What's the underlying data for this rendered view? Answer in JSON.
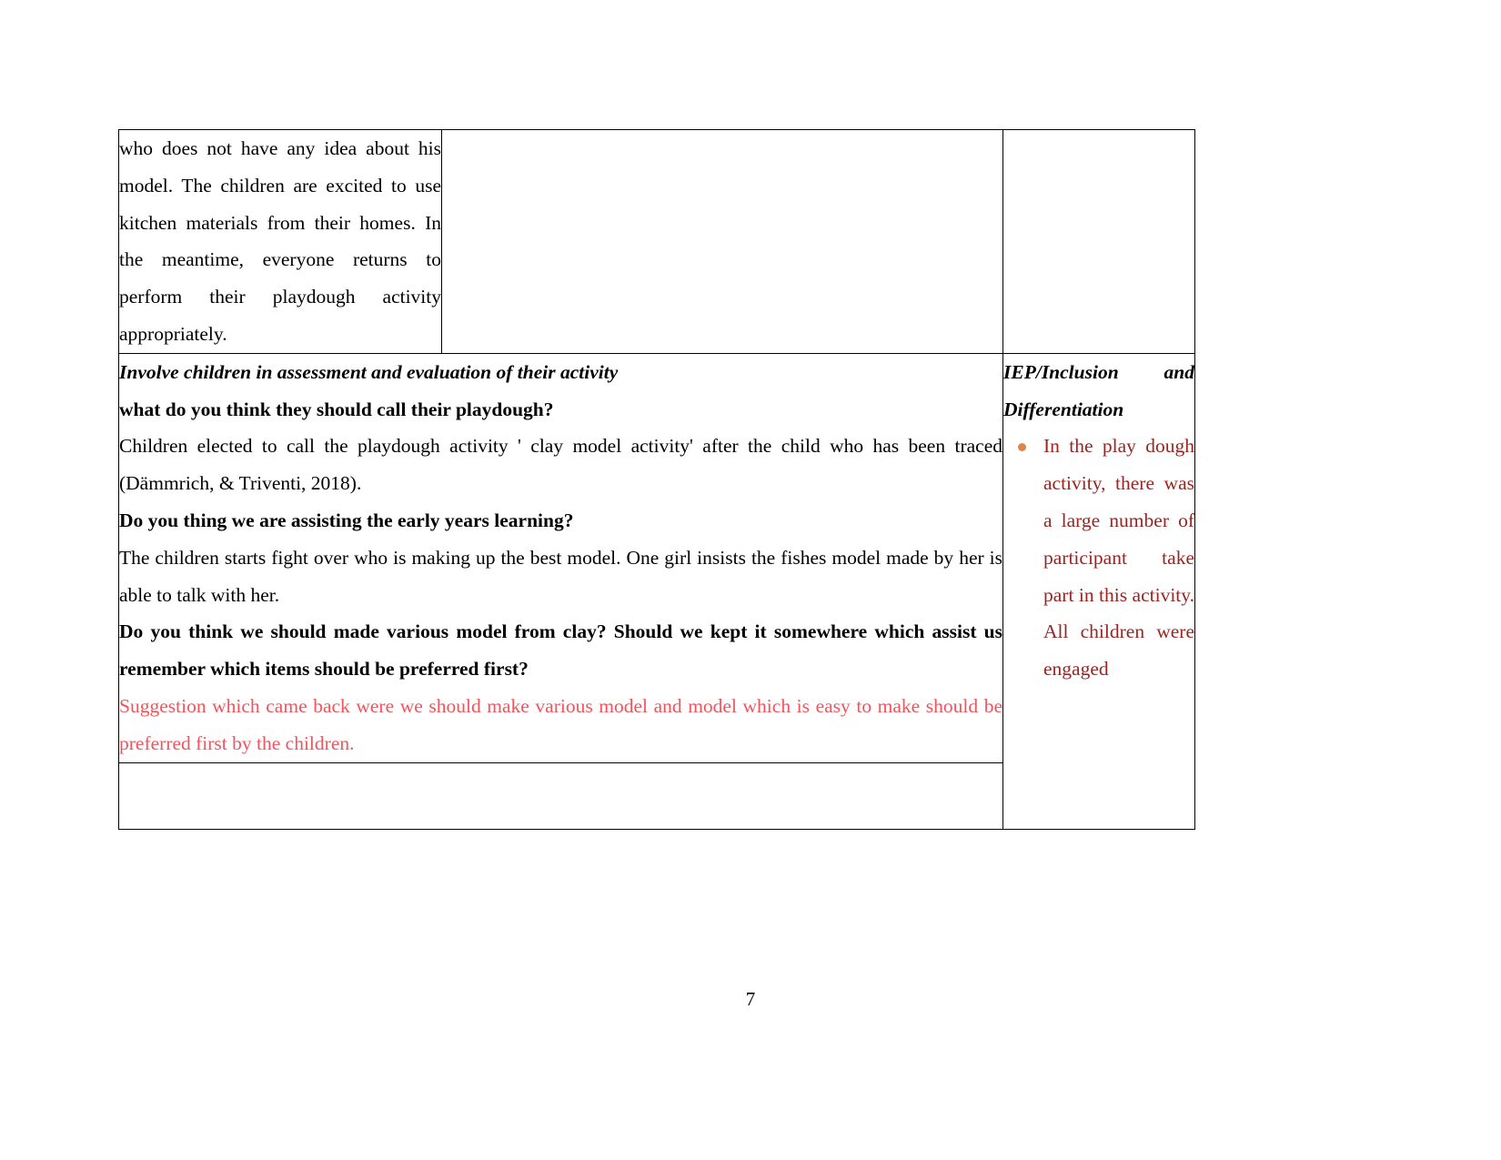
{
  "document": {
    "page_number": "7",
    "colors": {
      "body_text": "#000000",
      "suggestion_red": "#f4535c",
      "iep_dark_red": "#9b2420",
      "bullet_orange": "#e08547",
      "table_border": "#000000"
    }
  },
  "table": {
    "row1": {
      "continuation_paragraph": "who does not have any idea about his model. The children are excited to use kitchen materials from their homes. In the meantime, everyone returns to perform their playdough activity appropriately.",
      "middle_cell": "",
      "right_cell": ""
    },
    "row2": {
      "main": {
        "heading_italic": "Involve children in assessment and evaluation of their activity",
        "question_1": "what do you think they should call their playdough?",
        "answer_1": "Children elected to call the playdough activity ' clay model activity' after the child who has been traced (Dämmrich, & Triventi, 2018).",
        "question_2": "Do you thing we are assisting the early years learning?",
        "answer_2": "The children starts fight over who is making up the best model. One girl insists the fishes model made by her is able to talk with her.",
        "question_3": "Do you think we should made various model from clay? Should we kept it somewhere which assist us remember which items should be preferred first?",
        "answer_3_red": "Suggestion which came back were we should make various model and model which is easy to make should be preferred first by the children."
      },
      "iep": {
        "heading": "IEP/Inclusion and Differentiation",
        "bullets": [
          "In the play dough activity, there was a large number of participant take part in this activity. All children were engaged"
        ]
      }
    },
    "row3": {
      "empty_strip": ""
    }
  }
}
